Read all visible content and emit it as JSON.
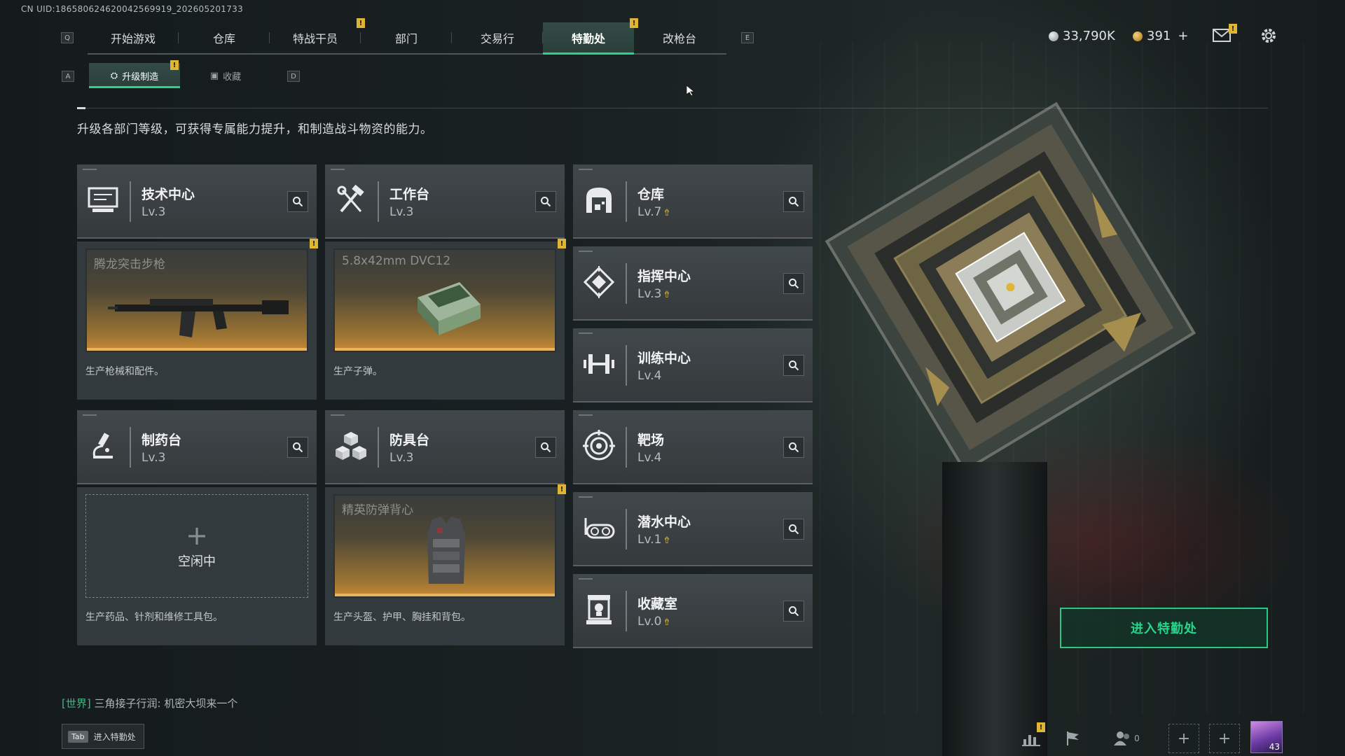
{
  "uid": "CN UID:186580624620042569919_202605201733",
  "nav": {
    "key_left": "Q",
    "key_right": "E",
    "tabs": [
      {
        "label": "开始游戏",
        "active": false,
        "badge": ""
      },
      {
        "label": "仓库",
        "active": false,
        "badge": ""
      },
      {
        "label": "特战干员",
        "active": false,
        "badge": "!"
      },
      {
        "label": "部门",
        "active": false,
        "badge": ""
      },
      {
        "label": "交易行",
        "active": false,
        "badge": ""
      },
      {
        "label": "特勤处",
        "active": true,
        "badge": "!"
      },
      {
        "label": "改枪台",
        "active": false,
        "badge": ""
      }
    ]
  },
  "currency": {
    "silver": "33,790K",
    "gold": "391",
    "gold_add": "+",
    "silver_color": "#c0c4c6",
    "gold_color": "#d9a43a"
  },
  "mail_badge": "!",
  "subnav": {
    "key_left": "A",
    "key_right": "D",
    "tabs": [
      {
        "label": "升级制造",
        "active": true,
        "badge": "!"
      },
      {
        "label": "收藏",
        "active": false,
        "badge": ""
      }
    ]
  },
  "description": "升级各部门等级，可获得专属能力提升，和制造战斗物资的能力。",
  "departments": [
    {
      "name": "技术中心",
      "level": "Lv.3",
      "upgradable": false,
      "icon": "monitor-icon"
    },
    {
      "name": "工作台",
      "level": "Lv.3",
      "upgradable": false,
      "icon": "tools-icon"
    },
    {
      "name": "仓库",
      "level": "Lv.7",
      "upgradable": true,
      "icon": "warehouse-icon"
    },
    {
      "name": "制药台",
      "level": "Lv.3",
      "upgradable": false,
      "icon": "microscope-icon"
    },
    {
      "name": "防具台",
      "level": "Lv.3",
      "upgradable": false,
      "icon": "cubes-icon"
    },
    {
      "name": "指挥中心",
      "level": "Lv.3",
      "upgradable": true,
      "icon": "command-diamond-icon"
    },
    {
      "name": "训练中心",
      "level": "Lv.4",
      "upgradable": false,
      "icon": "dumbbell-icon"
    },
    {
      "name": "靶场",
      "level": "Lv.4",
      "upgradable": false,
      "icon": "target-icon"
    },
    {
      "name": "潜水中心",
      "level": "Lv.1",
      "upgradable": true,
      "icon": "diving-goggles-icon"
    },
    {
      "name": "收藏室",
      "level": "Lv.0",
      "upgradable": true,
      "icon": "display-case-icon"
    }
  ],
  "production": [
    {
      "item": "腾龙突击步枪",
      "caption": "生产枪械和配件。",
      "badge": "!",
      "idle": false
    },
    {
      "item": "5.8x42mm DVC12",
      "caption": "生产子弹。",
      "badge": "!",
      "idle": false
    },
    {
      "item": "",
      "caption": "生产药品、针剂和维修工具包。",
      "badge": "",
      "idle": true,
      "idle_label": "空闲中"
    },
    {
      "item": "精英防弹背心",
      "caption": "生产头盔、护甲、胸挂和背包。",
      "badge": "!",
      "idle": false
    }
  ],
  "enter_button": "进入特勤处",
  "chat": {
    "channel": "[世界]",
    "message": "三角接子行润: 机密大坝来一个"
  },
  "tab_hint": {
    "key": "Tab",
    "label": "进入特勤处"
  },
  "bottom": {
    "friends_count": "0",
    "player_level": "43",
    "stats_badge": "!"
  }
}
